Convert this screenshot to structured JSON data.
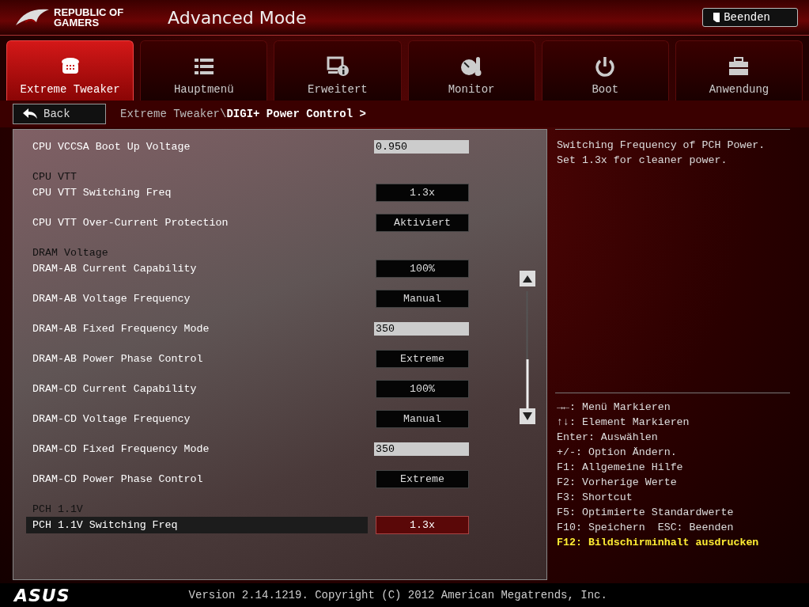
{
  "brand": {
    "line_1": "REPUBLIC OF",
    "line_2": "GAMERS"
  },
  "window": {
    "title": "Advanced Mode"
  },
  "exit_button": {
    "label": "Beenden"
  },
  "tabs": [
    {
      "label": "Extreme Tweaker",
      "selected": true
    },
    {
      "label": "Hauptmenü",
      "selected": false
    },
    {
      "label": "Erweitert",
      "selected": false
    },
    {
      "label": "Monitor",
      "selected": false
    },
    {
      "label": "Boot",
      "selected": false
    },
    {
      "label": "Anwendung",
      "selected": false
    }
  ],
  "back_button": {
    "label": "Back"
  },
  "breadcrumb": {
    "path": "Extreme Tweaker\\",
    "current": "DIGI+ Power Control >"
  },
  "settings": [
    {
      "kind": "input",
      "label": "CPU VCCSA Boot Up Voltage",
      "value": "0.950",
      "selected": false
    },
    {
      "kind": "heading",
      "label": "CPU VTT"
    },
    {
      "kind": "select",
      "label": "CPU VTT Switching Freq",
      "value": "1.3x",
      "selected": false
    },
    {
      "kind": "select",
      "label": "CPU VTT Over-Current Protection",
      "value": "Aktiviert",
      "selected": false
    },
    {
      "kind": "heading",
      "label": "DRAM Voltage"
    },
    {
      "kind": "select",
      "label": "DRAM-AB Current Capability",
      "value": "100%",
      "selected": false
    },
    {
      "kind": "select",
      "label": "DRAM-AB Voltage Frequency",
      "value": "Manual",
      "selected": false
    },
    {
      "kind": "input",
      "label": "DRAM-AB Fixed Frequency Mode",
      "value": "350",
      "selected": false
    },
    {
      "kind": "select",
      "label": "DRAM-AB Power Phase Control",
      "value": "Extreme",
      "selected": false
    },
    {
      "kind": "select",
      "label": "DRAM-CD Current Capability",
      "value": "100%",
      "selected": false
    },
    {
      "kind": "select",
      "label": "DRAM-CD Voltage Frequency",
      "value": "Manual",
      "selected": false
    },
    {
      "kind": "input",
      "label": "DRAM-CD Fixed Frequency Mode",
      "value": "350",
      "selected": false
    },
    {
      "kind": "select",
      "label": "DRAM-CD Power Phase Control",
      "value": "Extreme",
      "selected": false
    },
    {
      "kind": "heading",
      "label": "PCH 1.1V"
    },
    {
      "kind": "select",
      "label": "PCH 1.1V Switching Freq",
      "value": "1.3x",
      "selected": true
    }
  ],
  "help": {
    "description": [
      "Switching Frequency of PCH Power.",
      "Set 1.3x for cleaner power."
    ]
  },
  "key_hints": [
    {
      "text": "→←: Menü Markieren",
      "highlighted": false
    },
    {
      "text": "↑↓: Element Markieren",
      "highlighted": false
    },
    {
      "text": "Enter: Auswählen",
      "highlighted": false
    },
    {
      "text": "+/-: Option Ändern.",
      "highlighted": false
    },
    {
      "text": "F1: Allgemeine Hilfe",
      "highlighted": false
    },
    {
      "text": "F2: Vorherige Werte",
      "highlighted": false
    },
    {
      "text": "F3: Shortcut",
      "highlighted": false
    },
    {
      "text": "F5: Optimierte Standardwerte",
      "highlighted": false
    },
    {
      "text": "F10: Speichern  ESC: Beenden",
      "highlighted": false
    },
    {
      "text": "F12: Bildschirminhalt ausdrucken",
      "highlighted": true
    }
  ],
  "footer": {
    "logo": "ASUS",
    "version": "Version 2.14.1219. Copyright (C) 2012 American Megatrends, Inc."
  }
}
